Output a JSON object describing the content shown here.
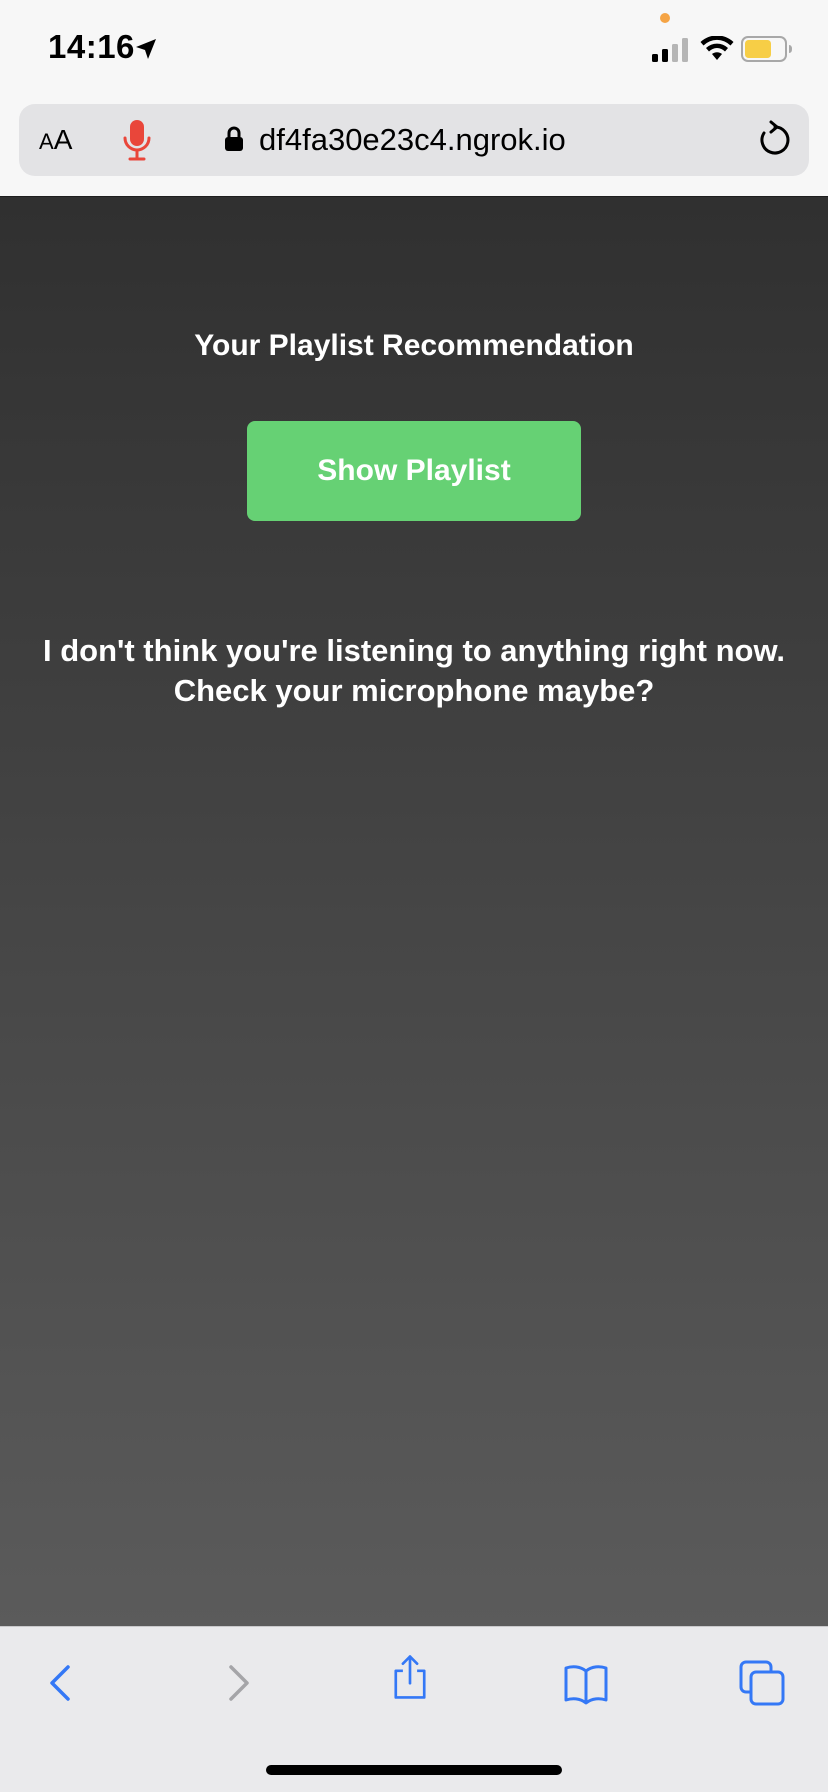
{
  "status_bar": {
    "time": "14:16"
  },
  "address_bar": {
    "text_size_label_small": "A",
    "text_size_label_large": "A",
    "url": "df4fa30e23c4.ngrok.io"
  },
  "page": {
    "title": "Your Playlist Recommendation",
    "button_label": "Show Playlist",
    "message_line1": "I don't think you're listening to anything right now.",
    "message_line2": "Check your microphone maybe?"
  },
  "colors": {
    "button_green": "#66d174",
    "mic_red": "#e9463a",
    "toolbar_blue": "#3478f6",
    "battery_yellow": "#f7ce46",
    "privacy_dot_orange": "#f5a445"
  },
  "icons": {
    "status": [
      "location-arrow-icon",
      "signal-icon",
      "wifi-icon",
      "battery-icon"
    ],
    "address": [
      "text-size-icon",
      "microphone-icon",
      "lock-icon",
      "reload-icon"
    ],
    "toolbar": [
      "back-icon",
      "forward-icon",
      "share-icon",
      "bookmarks-icon",
      "tabs-icon"
    ]
  }
}
